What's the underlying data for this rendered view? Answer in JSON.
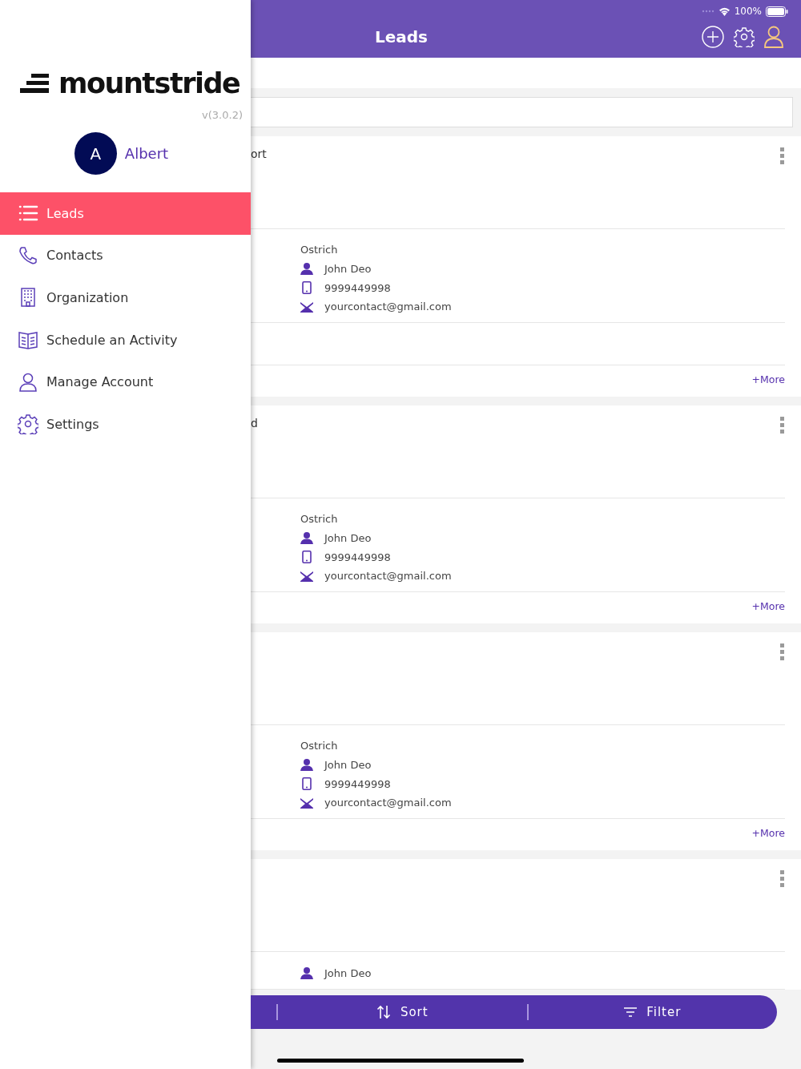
{
  "status_bar": {
    "battery": "100%"
  },
  "header": {
    "title": "Leads"
  },
  "drawer": {
    "brand": "mountstride",
    "version": "v(3.0.2)",
    "user": {
      "initial": "A",
      "name": "Albert"
    },
    "items": [
      {
        "label": "Leads",
        "selected": true
      },
      {
        "label": "Contacts",
        "selected": false
      },
      {
        "label": "Organization",
        "selected": false
      },
      {
        "label": "Schedule an Activity",
        "selected": false
      },
      {
        "label": "Manage Account",
        "selected": false
      },
      {
        "label": "Settings",
        "selected": false
      }
    ]
  },
  "cards": [
    {
      "top_text": "ort",
      "company": "Ostrich",
      "rows": [
        {
          "kind": "person",
          "text": "John Deo"
        },
        {
          "kind": "phone",
          "text": "9999449998"
        },
        {
          "kind": "email",
          "text": "yourcontact@gmail.com"
        }
      ],
      "extra_section": true,
      "more": "+More"
    },
    {
      "top_text": "d",
      "company": "Ostrich",
      "rows": [
        {
          "kind": "person",
          "text": "John Deo"
        },
        {
          "kind": "phone",
          "text": "9999449998"
        },
        {
          "kind": "email",
          "text": "yourcontact@gmail.com"
        }
      ],
      "extra_section": false,
      "more": "+More"
    },
    {
      "company": "Ostrich",
      "rows": [
        {
          "kind": "person",
          "text": "John Deo"
        },
        {
          "kind": "phone",
          "text": "9999449998"
        },
        {
          "kind": "email",
          "text": "yourcontact@gmail.com"
        }
      ],
      "extra_section": false,
      "more": "+More"
    },
    {
      "rows": [
        {
          "kind": "person",
          "text": "John Deo"
        }
      ],
      "extra_section": false
    }
  ],
  "bottom_bar": {
    "sort": "Sort",
    "filter": "Filter"
  }
}
